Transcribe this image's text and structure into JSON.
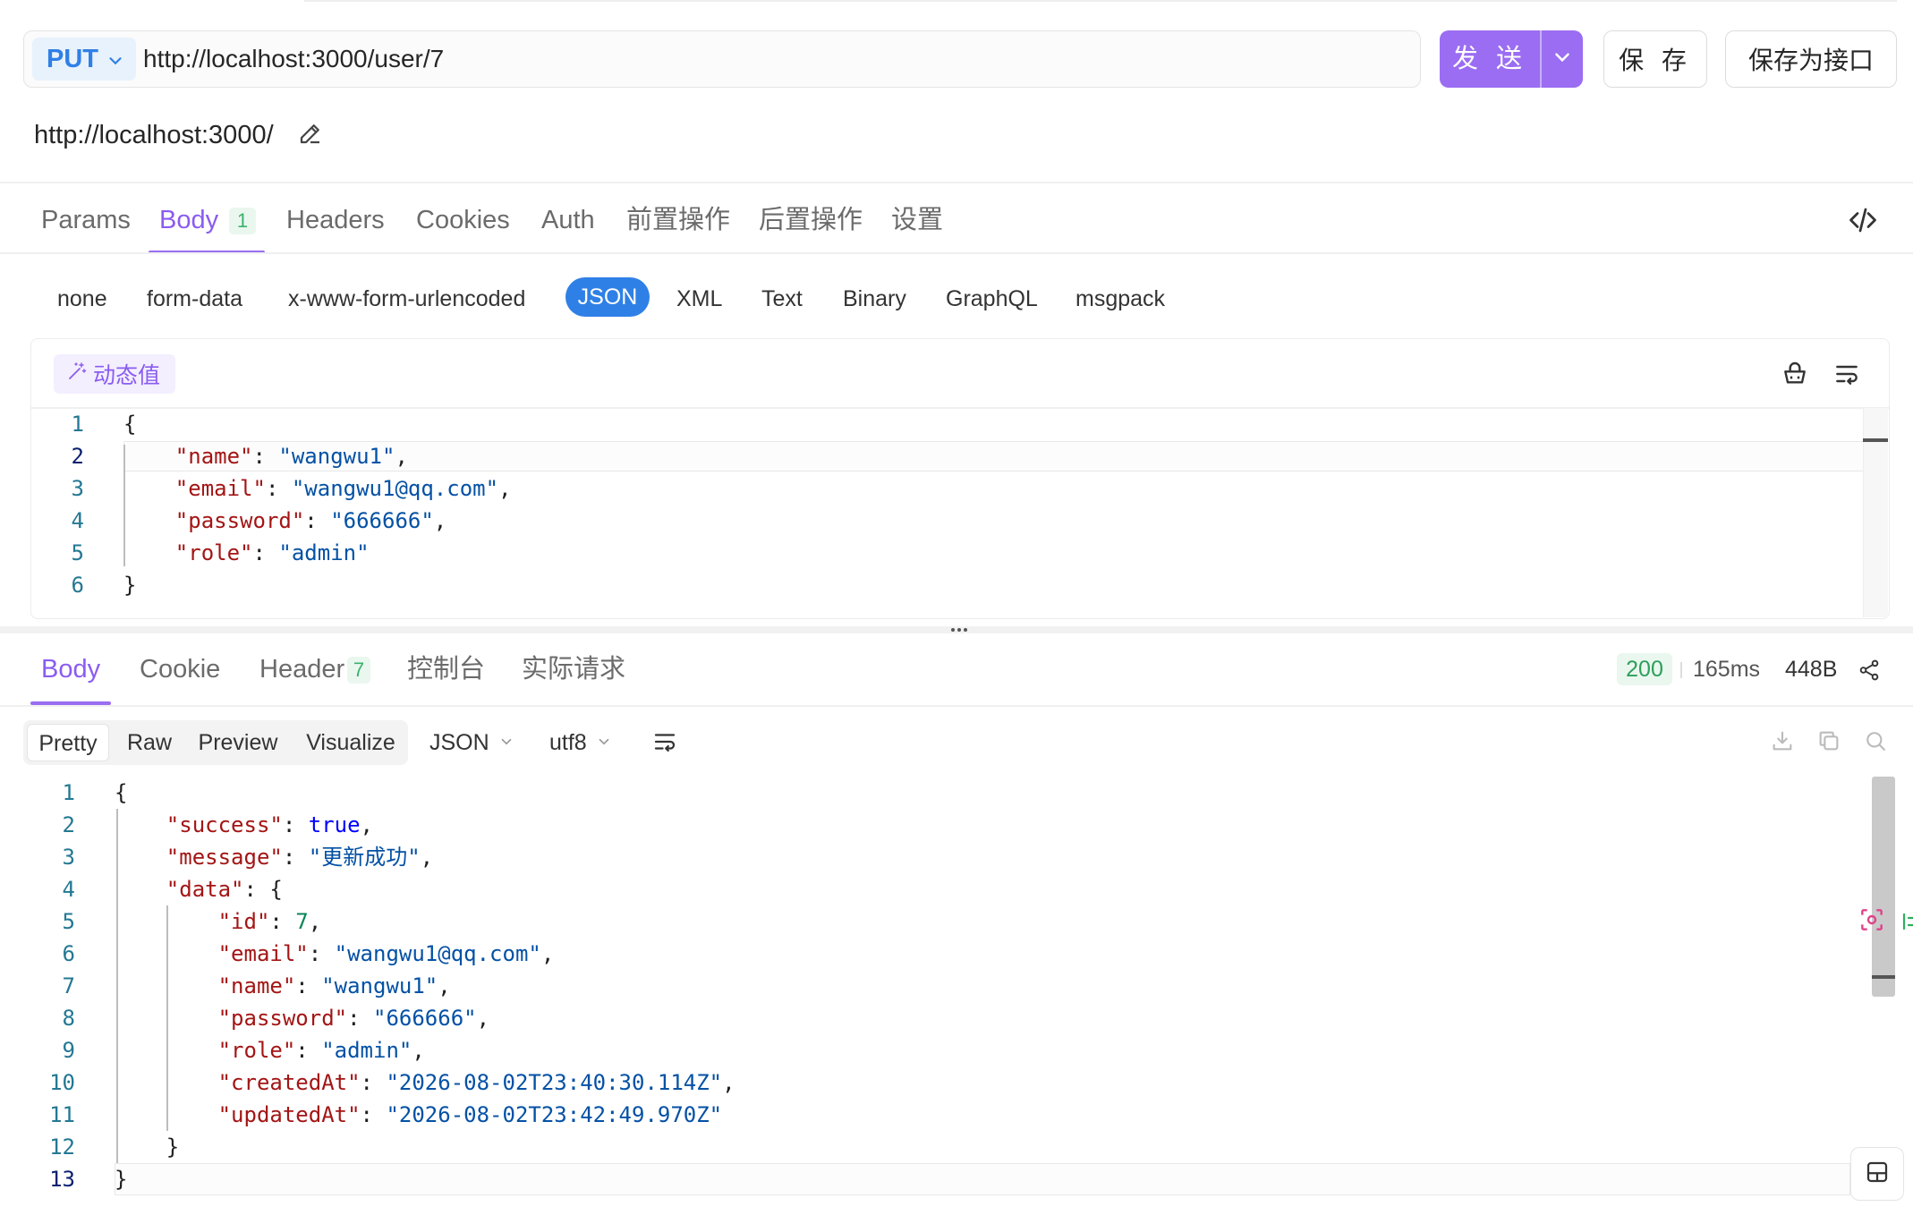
{
  "request": {
    "method": "PUT",
    "url": "http://localhost:3000/user/7",
    "send_label": "发 送",
    "save_label": "保 存",
    "save_as_label": "保存为接口",
    "base_url": "http://localhost:3000/"
  },
  "request_tabs": {
    "params": "Params",
    "body": "Body",
    "body_count": "1",
    "headers": "Headers",
    "cookies": "Cookies",
    "auth": "Auth",
    "pre_ops": "前置操作",
    "post_ops": "后置操作",
    "settings": "设置",
    "active": "Body"
  },
  "body_types": {
    "none": "none",
    "form_data": "form-data",
    "urlencoded": "x-www-form-urlencoded",
    "json": "JSON",
    "xml": "XML",
    "text": "Text",
    "binary": "Binary",
    "graphql": "GraphQL",
    "msgpack": "msgpack",
    "selected": "JSON"
  },
  "request_editor": {
    "dynamic_value_label": "动态值",
    "line_numbers": [
      "1",
      "2",
      "3",
      "4",
      "5",
      "6"
    ],
    "current_line": "2",
    "lines": {
      "l1_open": "{",
      "name_key": "\"name\"",
      "name_val": "\"wangwu1\"",
      "email_key": "\"email\"",
      "email_val": "\"wangwu1@qq.com\"",
      "password_key": "\"password\"",
      "password_val": "\"666666\"",
      "role_key": "\"role\"",
      "role_val": "\"admin\"",
      "l6_close": "}"
    }
  },
  "response_tabs": {
    "body": "Body",
    "cookie": "Cookie",
    "header": "Header",
    "header_count": "7",
    "console": "控制台",
    "actual_request": "实际请求",
    "active": "Body"
  },
  "response_meta": {
    "status": "200",
    "time": "165ms",
    "size": "448B",
    "status_color": "#2e9e5b"
  },
  "response_view": {
    "pretty": "Pretty",
    "raw": "Raw",
    "preview": "Preview",
    "visualize": "Visualize",
    "format": "JSON",
    "encoding": "utf8",
    "active": "Pretty"
  },
  "response_editor": {
    "line_numbers": [
      "1",
      "2",
      "3",
      "4",
      "5",
      "6",
      "7",
      "8",
      "9",
      "10",
      "11",
      "12",
      "13"
    ],
    "current_line": "13",
    "open": "{",
    "success_key": "\"success\"",
    "success_val": "true",
    "message_key": "\"message\"",
    "message_val": "\"更新成功\"",
    "data_key": "\"data\"",
    "data_open": "{",
    "id_key": "\"id\"",
    "id_val": "7",
    "email_key": "\"email\"",
    "email_val": "\"wangwu1@qq.com\"",
    "name_key": "\"name\"",
    "name_val": "\"wangwu1\"",
    "password_key": "\"password\"",
    "password_val": "\"666666\"",
    "role_key": "\"role\"",
    "role_val": "\"admin\"",
    "created_key": "\"createdAt\"",
    "created_val": "\"2026-08-02T23:40:30.114Z\"",
    "updated_key": "\"updatedAt\"",
    "updated_val": "\"2026-08-02T23:42:49.970Z\"",
    "data_close": "}",
    "close": "}"
  },
  "colors": {
    "accent": "#9b6df2",
    "method_blue": "#2f80e6",
    "json_key": "#a31515",
    "json_string": "#0451a5",
    "json_number": "#098658"
  },
  "icons": {
    "method_dropdown": "chevron-down-icon",
    "send_dropdown": "chevron-down-icon",
    "base_url_edit": "pencil-icon",
    "code_view": "code-icon",
    "dynamic_value": "magic-wand-icon",
    "clean": "basket-icon",
    "wrap": "wrap-lines-icon",
    "share": "share-icon",
    "download": "download-icon",
    "copy": "copy-icon",
    "search": "search-icon",
    "layout_panel": "layout-panel-icon"
  }
}
